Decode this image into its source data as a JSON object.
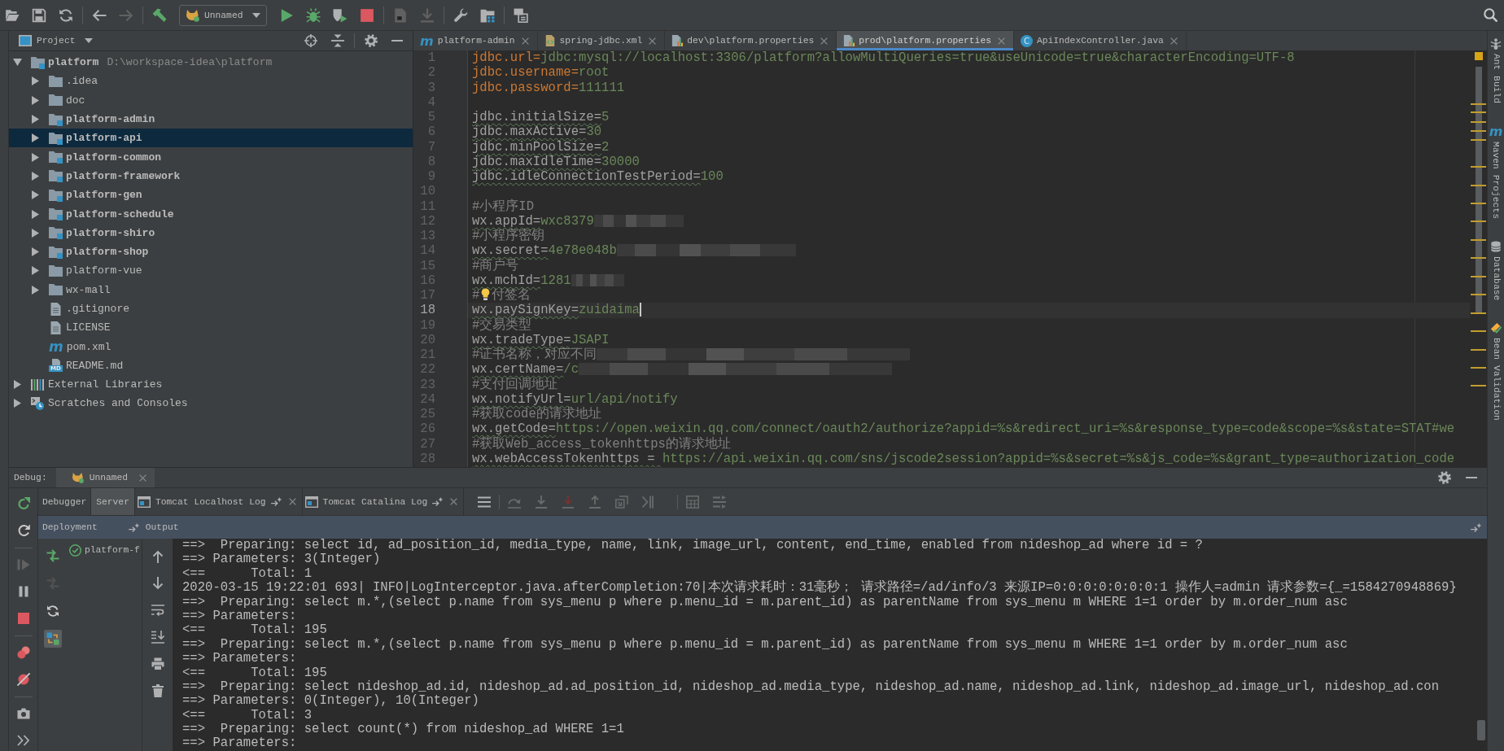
{
  "toolbar": {
    "groups": [
      [
        {
          "kind": "open",
          "disabled": false
        },
        {
          "kind": "save",
          "disabled": false
        },
        {
          "kind": "sync",
          "disabled": false
        }
      ],
      [
        {
          "kind": "back",
          "disabled": false
        },
        {
          "kind": "forward",
          "disabled": true
        }
      ],
      [
        {
          "kind": "build",
          "disabled": false
        },
        {
          "kind": "config",
          "label": "Unnamed",
          "disabled": false
        },
        {
          "kind": "run",
          "disabled": false
        },
        {
          "kind": "debug",
          "disabled": false
        },
        {
          "kind": "coverage",
          "disabled": false
        },
        {
          "kind": "stop",
          "disabled": false
        }
      ],
      [
        {
          "kind": "document",
          "disabled": true
        },
        {
          "kind": "download",
          "disabled": true
        }
      ],
      [
        {
          "kind": "wrench",
          "disabled": false
        },
        {
          "kind": "structure",
          "disabled": false
        }
      ],
      [
        {
          "kind": "layers",
          "disabled": false
        }
      ]
    ]
  },
  "project_panel": {
    "title": "Project",
    "tree": [
      {
        "label": "platform",
        "path": "D:\\workspace-idea\\platform",
        "kind": "module",
        "expanded": true,
        "selected": false,
        "children": [
          {
            "label": ".idea",
            "kind": "folder",
            "expanded": false,
            "selected": false
          },
          {
            "label": "doc",
            "kind": "folder",
            "expanded": false,
            "selected": false
          },
          {
            "label": "platform-admin",
            "kind": "module",
            "expanded": false,
            "selected": false
          },
          {
            "label": "platform-api",
            "kind": "module",
            "expanded": false,
            "selected": true
          },
          {
            "label": "platform-common",
            "kind": "module",
            "expanded": false,
            "selected": false
          },
          {
            "label": "platform-framework",
            "kind": "module",
            "expanded": false,
            "selected": false
          },
          {
            "label": "platform-gen",
            "kind": "module",
            "expanded": false,
            "selected": false
          },
          {
            "label": "platform-schedule",
            "kind": "module",
            "expanded": false,
            "selected": false
          },
          {
            "label": "platform-shiro",
            "kind": "module",
            "expanded": false,
            "selected": false
          },
          {
            "label": "platform-shop",
            "kind": "module",
            "expanded": false,
            "selected": false
          },
          {
            "label": "platform-vue",
            "kind": "folder",
            "expanded": false,
            "selected": false
          },
          {
            "label": "wx-mall",
            "kind": "folder",
            "expanded": false,
            "selected": false
          },
          {
            "label": ".gitignore",
            "kind": "file",
            "selected": false
          },
          {
            "label": "LICENSE",
            "kind": "file",
            "selected": false
          },
          {
            "label": "pom.xml",
            "kind": "maven",
            "glyph": "m",
            "selected": false
          },
          {
            "label": "README.md",
            "kind": "markdown",
            "glyph": "MD",
            "selected": false
          }
        ]
      },
      {
        "label": "External Libraries",
        "kind": "libraries",
        "expanded": false,
        "selected": false
      },
      {
        "label": "Scratches and Consoles",
        "kind": "scratches",
        "expanded": false,
        "selected": false
      }
    ]
  },
  "editor": {
    "tabs": [
      {
        "label": "platform-admin",
        "kind": "maven",
        "glyph": "m",
        "selected": false
      },
      {
        "label": "spring-jdbc.xml",
        "kind": "xml",
        "selected": false
      },
      {
        "label": "dev\\platform.properties",
        "kind": "properties",
        "selected": false
      },
      {
        "label": "prod\\platform.properties",
        "kind": "properties",
        "selected": true
      },
      {
        "label": "ApiIndexController.java",
        "kind": "class",
        "glyph": "C",
        "selected": false
      }
    ],
    "lines": [
      {
        "number": "1",
        "kind": "prop",
        "key": "jdbc.url=",
        "value": "jdbc:mysql://localhost:3306/platform?allowMultiQueries=true&useUnicode=true&characterEncoding=UTF-8",
        "used": true,
        "typo": false,
        "current": false
      },
      {
        "number": "2",
        "kind": "prop",
        "key": "jdbc.username=",
        "value": "root",
        "used": true,
        "typo": false,
        "current": false
      },
      {
        "number": "3",
        "kind": "prop",
        "key": "jdbc.password=",
        "value": "111111",
        "used": true,
        "typo": false,
        "current": false
      },
      {
        "number": "4",
        "kind": "blank",
        "current": false
      },
      {
        "number": "5",
        "kind": "prop",
        "key": "jdbc.initialSize=",
        "value": "5",
        "used": false,
        "typo": true,
        "current": false
      },
      {
        "number": "6",
        "kind": "prop",
        "key": "jdbc.maxActive=",
        "value": "30",
        "used": false,
        "typo": true,
        "current": false
      },
      {
        "number": "7",
        "kind": "prop",
        "key": "jdbc.minPoolSize=",
        "value": "2",
        "used": false,
        "typo": true,
        "current": false
      },
      {
        "number": "8",
        "kind": "prop",
        "key": "jdbc.maxIdleTime=",
        "value": "30000",
        "used": false,
        "typo": true,
        "current": false
      },
      {
        "number": "9",
        "kind": "prop",
        "key": "jdbc.idleConnectionTestPeriod=",
        "value": "100",
        "used": false,
        "typo": true,
        "current": false
      },
      {
        "number": "10",
        "kind": "blank",
        "current": false
      },
      {
        "number": "11",
        "kind": "comment",
        "text": "#小程序ID",
        "current": false
      },
      {
        "number": "12",
        "kind": "prop",
        "key": "wx.appId=",
        "value": "wxc8379",
        "used": false,
        "typo": true,
        "current": false,
        "redaction": {
          "kind": "short"
        }
      },
      {
        "number": "13",
        "kind": "comment",
        "text": "#小程序密钥",
        "current": false
      },
      {
        "number": "14",
        "kind": "prop",
        "key": "wx.secret=",
        "value": "4e78e048b",
        "used": false,
        "typo": true,
        "current": false,
        "redaction": {
          "kind": "medium"
        }
      },
      {
        "number": "15",
        "kind": "comment",
        "text": "#商户号",
        "current": false
      },
      {
        "number": "16",
        "kind": "prop",
        "key": "wx.mchId=",
        "value": "1281",
        "used": false,
        "typo": true,
        "current": false,
        "redaction": {
          "kind": "tiny"
        }
      },
      {
        "number": "17",
        "kind": "hinted-comment",
        "text": "#",
        "text_after": "付签名",
        "current": false
      },
      {
        "number": "18",
        "kind": "prop",
        "key": "wx.paySignKey=",
        "value": "zuidaima",
        "used": false,
        "typo": true,
        "current": true
      },
      {
        "number": "19",
        "kind": "comment",
        "text": "#交易类型",
        "current": false
      },
      {
        "number": "20",
        "kind": "prop",
        "key": "wx.tradeType=",
        "value": "JSAPI",
        "used": false,
        "typo": true,
        "current": false
      },
      {
        "number": "21",
        "kind": "comment",
        "text": "#证书名称，对应不同",
        "current": false,
        "redaction": {
          "kind": "long"
        }
      },
      {
        "number": "22",
        "kind": "prop",
        "key": "wx.certName=",
        "value": "/c",
        "used": false,
        "typo": true,
        "current": false,
        "redaction": {
          "kind": "long"
        }
      },
      {
        "number": "23",
        "kind": "comment",
        "text": "#支付回调地址",
        "current": false
      },
      {
        "number": "24",
        "kind": "prop",
        "key": "wx.notifyUrl=",
        "value": "url/api/notify",
        "used": false,
        "typo": true,
        "current": false
      },
      {
        "number": "25",
        "kind": "comment",
        "text": "#获取code的请求地址",
        "current": false
      },
      {
        "number": "26",
        "kind": "prop",
        "key": "wx.getCode=",
        "value": "https://open.weixin.qq.com/connect/oauth2/authorize?appid=%s&redirect_uri=%s&response_type=code&scope=%s&state=STAT#we",
        "used": false,
        "typo": true,
        "current": false
      },
      {
        "number": "27",
        "kind": "comment",
        "text": "#获取Web_access_tokenhttps的请求地址",
        "current": false
      },
      {
        "number": "28",
        "kind": "prop",
        "key": "wx.webAccessTokenhttps = ",
        "value": "https://api.weixin.qq.com/sns/jscode2session?appid=%s&secret=%s&js_code=%s&grant_type=authorization_code",
        "used": false,
        "typo": true,
        "current": false
      }
    ]
  },
  "tool_windows": [
    {
      "label": "Ant Build",
      "kind": "ant"
    },
    {
      "label": "Maven Projects",
      "kind": "maven",
      "glyph": "m"
    },
    {
      "label": "Database",
      "kind": "database"
    },
    {
      "label": "Bean Validation",
      "kind": "bean"
    }
  ],
  "debug_panel": {
    "title": "Debug:",
    "sessions": [
      {
        "label": "Unnamed",
        "selected": true
      }
    ],
    "actions": [
      [
        {
          "kind": "rerun",
          "disabled": false
        },
        {
          "kind": "restart",
          "disabled": false
        }
      ],
      [
        {
          "kind": "resume",
          "disabled": true
        },
        {
          "kind": "pause",
          "disabled": false
        },
        {
          "kind": "stop",
          "disabled": false
        }
      ],
      [
        {
          "kind": "breakpoints",
          "disabled": false
        },
        {
          "kind": "mute",
          "disabled": false
        }
      ],
      [
        {
          "kind": "camera",
          "disabled": false
        },
        {
          "kind": "more",
          "disabled": false
        }
      ]
    ],
    "tabs": [
      {
        "label": "Debugger",
        "kind": "plain",
        "selected": false
      },
      {
        "label": "Server",
        "kind": "plain",
        "selected": true
      },
      {
        "label": "Tomcat Localhost Log",
        "kind": "log",
        "selected": false
      },
      {
        "label": "Tomcat Catalina Log",
        "kind": "log",
        "selected": false
      }
    ],
    "deployment": {
      "title": "Deployment",
      "output_title": "Output",
      "tools": [
        {
          "kind": "deploy",
          "disabled": false,
          "on": false
        },
        {
          "kind": "undeploy",
          "disabled": true,
          "on": false
        },
        {
          "kind": "refresh",
          "disabled": false,
          "on": false
        },
        {
          "kind": "artifact",
          "disabled": false,
          "on": true
        }
      ],
      "items": [
        {
          "label": "platform-f",
          "kind": "deployed",
          "selected": false
        }
      ]
    },
    "console": {
      "lines": [
        "==>  Preparing: select id, ad_position_id, media_type, name, link, image_url, content, end_time, enabled from nideshop_ad where id = ?",
        "==> Parameters: 3(Integer)",
        "<==      Total: 1",
        "2020-03-15 19:22:01 693| INFO|LogInterceptor.java.afterCompletion:70|本次请求耗时：31毫秒； 请求路径=/ad/info/3 来源IP=0:0:0:0:0:0:0:1 操作人=admin 请求参数={_=1584270948869}",
        "==>  Preparing: select m.*,(select p.name from sys_menu p where p.menu_id = m.parent_id) as parentName from sys_menu m WHERE 1=1 order by m.order_num asc",
        "==> Parameters:",
        "<==      Total: 195",
        "==>  Preparing: select m.*,(select p.name from sys_menu p where p.menu_id = m.parent_id) as parentName from sys_menu m WHERE 1=1 order by m.order_num asc",
        "==> Parameters:",
        "<==      Total: 195",
        "==>  Preparing: select nideshop_ad.id, nideshop_ad.ad_position_id, nideshop_ad.media_type, nideshop_ad.name, nideshop_ad.link, nideshop_ad.image_url, nideshop_ad.con",
        "==> Parameters: 0(Integer), 10(Integer)",
        "<==      Total: 3",
        "==>  Preparing: select count(*) from nideshop_ad WHERE 1=1",
        "==> Parameters:"
      ]
    }
  }
}
